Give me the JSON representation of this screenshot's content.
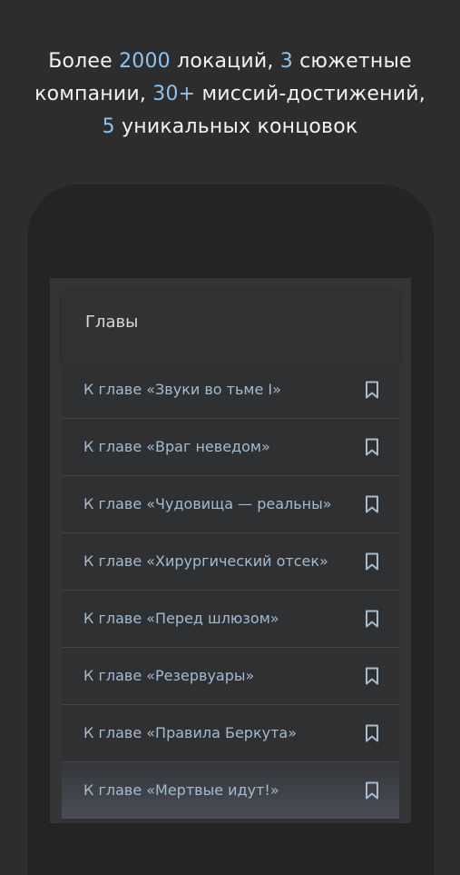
{
  "promo": {
    "l1_a": "Более ",
    "l1_b": "2000",
    "l1_c": " локаций, ",
    "l1_d": "3",
    "l1_e": " сюжетные",
    "l2_a": "компании, ",
    "l2_b": "30+",
    "l2_c": " миссий-достижений,",
    "l3_a": "5",
    "l3_b": " уникальных концовок"
  },
  "colors": {
    "background": "#2d2d2e",
    "highlight": "#8fc3ec",
    "link_text": "#a3bbd0"
  },
  "panel": {
    "title": "Главы",
    "items": [
      {
        "label": "К главе «Звуки во тьме I»",
        "icon": "bookmark-icon"
      },
      {
        "label": "К главе «Враг неведом»",
        "icon": "bookmark-icon"
      },
      {
        "label": "К главе «Чудовища — реальны»",
        "icon": "bookmark-icon"
      },
      {
        "label": "К главе «Хирургический отсек»",
        "icon": "bookmark-icon"
      },
      {
        "label": "К главе «Перед шлюзом»",
        "icon": "bookmark-icon"
      },
      {
        "label": "К главе «Резервуары»",
        "icon": "bookmark-icon"
      },
      {
        "label": "К главе «Правила Беркута»",
        "icon": "bookmark-icon"
      },
      {
        "label": "К главе «Мертвые идут!»",
        "icon": "bookmark-icon"
      }
    ]
  }
}
